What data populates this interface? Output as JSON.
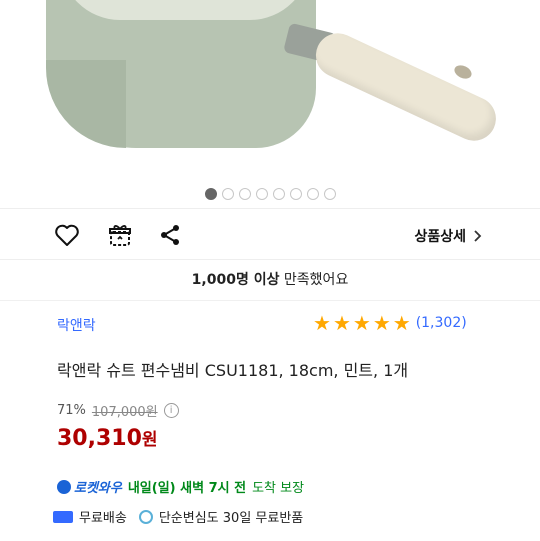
{
  "gallery": {
    "dot_count": 8,
    "active_index": 0
  },
  "actions": {
    "detail_label": "상품상세"
  },
  "banner": {
    "bold": "1,000명 이상",
    "rest": " 만족했어요"
  },
  "product": {
    "brand": "락앤락",
    "rating_stars": 5,
    "review_count": "(1,302)",
    "title": "락앤락 슈트 편수냄비 CSU1181, 18cm, 민트, 1개",
    "discount": "71%",
    "original_price": "107,000원",
    "price": "30,310",
    "price_unit": "원"
  },
  "delivery": {
    "badge": "로켓와우",
    "date_bold": "내일(일) 새벽 7시 전",
    "date_rest": "도착 보장",
    "free_shipping": "무료배송",
    "return_policy": "단순변심도 30일 무료반품"
  },
  "colors": {
    "price": "#ae0000",
    "link": "#346aff",
    "star": "#ffa800",
    "rocket": "#1a63d6",
    "delivery_green": "#00891a"
  }
}
